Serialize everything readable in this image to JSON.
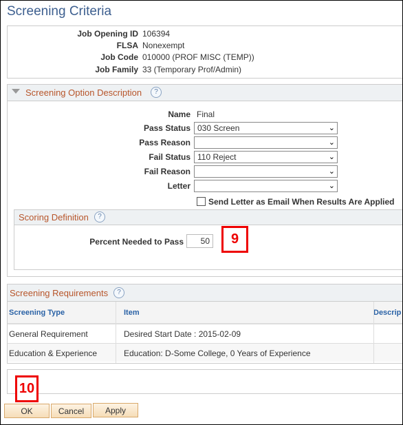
{
  "title": "Screening Criteria",
  "job_info": [
    {
      "label": "Job Opening ID",
      "value": "106394"
    },
    {
      "label": "FLSA",
      "value": "Nonexempt"
    },
    {
      "label": "Job Code",
      "value": "010000 (PROF MISC (TEMP))"
    },
    {
      "label": "Job Family",
      "value": "33 (Temporary Prof/Admin)"
    }
  ],
  "option": {
    "header": "Screening Option Description",
    "name_label": "Name",
    "name_value": "Final",
    "fields": [
      {
        "label": "Pass Status",
        "value": "030 Screen"
      },
      {
        "label": "Pass Reason",
        "value": ""
      },
      {
        "label": "Fail Status",
        "value": "110 Reject"
      },
      {
        "label": "Fail Reason",
        "value": ""
      },
      {
        "label": "Letter",
        "value": ""
      }
    ],
    "checkbox_label": "Send Letter as Email When Results Are Applied",
    "checkbox_checked": false
  },
  "scoring": {
    "header": "Scoring Definition",
    "percent_label": "Percent Needed to Pass",
    "percent_value": "50"
  },
  "requirements": {
    "header": "Screening Requirements",
    "columns": [
      "Screening Type",
      "Item",
      "Descrip"
    ],
    "rows": [
      [
        "General Requirement",
        "Desired Start Date : 2015-02-09",
        ""
      ],
      [
        "Education & Experience",
        "Education: D-Some College, 0 Years of Experience",
        ""
      ]
    ]
  },
  "callouts": {
    "step9": "9",
    "step10": "10",
    "color": "#e00000"
  },
  "buttons": {
    "ok": "OK",
    "cancel": "Cancel",
    "apply": "Apply"
  },
  "help_glyph": "?",
  "chevron_glyph": "⌄"
}
